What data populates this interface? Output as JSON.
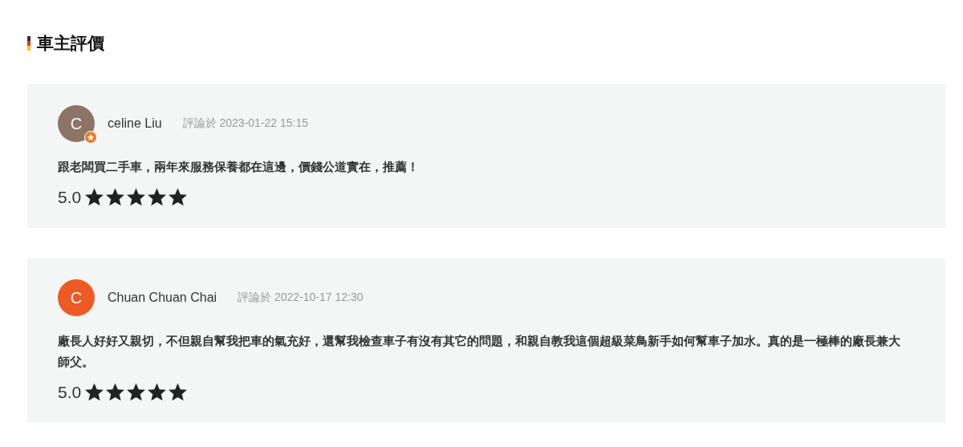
{
  "section": {
    "title": "車主評價"
  },
  "reviews": [
    {
      "initial": "C",
      "color": "#8c7466",
      "badge": true,
      "name": "celine Liu",
      "date": "評論於 2023-01-22 15:15",
      "text": "跟老闆買二手車，兩年來服務保養都在這邊，價錢公道實在，推薦！",
      "rating": "5.0",
      "stars": 5
    },
    {
      "initial": "C",
      "color": "#ee5a24",
      "badge": false,
      "name": "Chuan Chuan Chai",
      "date": "評論於 2022-10-17 12:30",
      "text": "廠長人好好又親切，不但親自幫我把車的氣充好，還幫我檢查車子有沒有其它的問題，和親自教我這個超級菜鳥新手如何幫車子加水。真的是一極棒的廠長兼大師父。",
      "rating": "5.0",
      "stars": 5
    }
  ]
}
